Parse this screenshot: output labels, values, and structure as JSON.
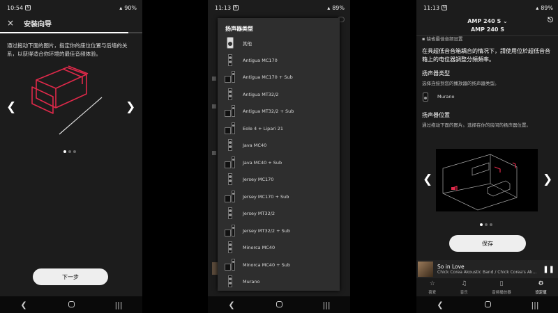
{
  "phone1": {
    "status": {
      "time": "10:54",
      "notif": "N",
      "battery": "90%"
    },
    "close_icon": "×",
    "title": "安装向导",
    "progress": 0.9,
    "instructions": "通过拖动下面的图片，指定你的座位位置与后墙的关系，以获得适合你环境的最佳音频体验。",
    "prev": "❮",
    "next": "❯",
    "dots": {
      "count": 3,
      "active": 0
    },
    "next_button": "下一步"
  },
  "phone2": {
    "status": {
      "time": "11:13",
      "notif": "N",
      "battery": "89%"
    },
    "dialog_title": "扬声器类型",
    "speakers": [
      {
        "label": "其他",
        "icon": "other-speaker-icon"
      },
      {
        "label": "Antigua MC170",
        "icon": "tower-speaker-icon"
      },
      {
        "label": "Antigua MC170 + Sub",
        "icon": "tower-sub-speaker-icon"
      },
      {
        "label": "Antigua MT32/2",
        "icon": "tower-speaker-icon"
      },
      {
        "label": "Antigua MT32/2 + Sub",
        "icon": "tower-sub-speaker-icon"
      },
      {
        "label": "Eole 4 + Lipari 21",
        "icon": "satellite-sub-icon"
      },
      {
        "label": "Java MC40",
        "icon": "tower-speaker-icon"
      },
      {
        "label": "Java MC40 + Sub",
        "icon": "tower-sub-speaker-icon"
      },
      {
        "label": "Jersey MC170",
        "icon": "slim-speaker-icon"
      },
      {
        "label": "Jersey MC170 + Sub",
        "icon": "tower-sub-speaker-icon"
      },
      {
        "label": "Jersey MT32/2",
        "icon": "slim-speaker-icon"
      },
      {
        "label": "Jersey MT32/2 + Sub",
        "icon": "tower-sub-speaker-icon"
      },
      {
        "label": "Minorca MC40",
        "icon": "bookshelf-speaker-icon"
      },
      {
        "label": "Minorca MC40 + Sub",
        "icon": "bookshelf-sub-speaker-icon"
      },
      {
        "label": "Murano",
        "icon": "murano-speaker-icon"
      }
    ]
  },
  "phone3": {
    "status": {
      "time": "11:13",
      "notif": "N",
      "battery": "89%"
    },
    "device": "AMP 240 S ⌄",
    "subtitle": "AMP 240 S",
    "truncated_line": "▪ 缺省最佳音频设置",
    "crossover_note": "在具超低音音箱耦合的情况下，請使用位於超低音音箱上的电位器調整分頻頻率。",
    "speaker_type_title": "扬声器类型",
    "speaker_type_desc": "选择连接到您的播放器的扬声器类型。",
    "selected_speaker": "Murano",
    "position_title": "扬声器位置",
    "position_desc": "通过拖动下面的图片。选择在你的房间的扬声器位置。",
    "prev": "❮",
    "next": "❯",
    "dots": {
      "count": 3,
      "active": 0
    },
    "save_button": "保存",
    "player": {
      "title": "So in Love",
      "artist": "Chick Corea Akoustic Band / Chick Corea's Ak...",
      "pause": "❚❚"
    },
    "tabs": [
      {
        "label": "喜爱",
        "icon": "☆"
      },
      {
        "label": "音乐",
        "icon": "♫"
      },
      {
        "label": "音频播放器",
        "icon": "▯"
      },
      {
        "label": "设定值",
        "icon": "⚙"
      }
    ],
    "active_tab": 3
  },
  "navbar": {
    "back": "❮",
    "recents": "|||"
  }
}
